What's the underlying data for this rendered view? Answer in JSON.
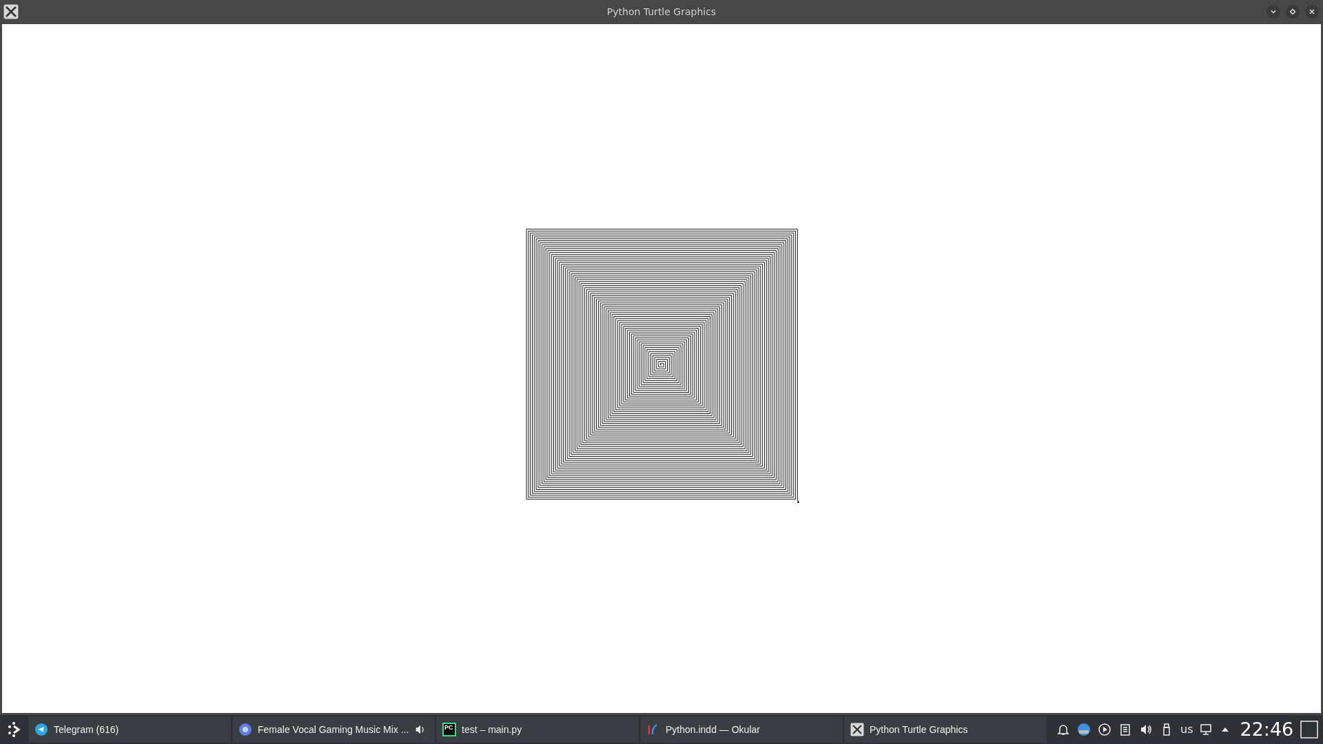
{
  "window": {
    "title": "Python Turtle Graphics"
  },
  "taskbar": {
    "tasks": [
      {
        "kind": "telegram",
        "label": "Telegram (616)",
        "audio": false
      },
      {
        "kind": "browser",
        "label": "Female Vocal Gaming Music Mix ...",
        "audio": true
      },
      {
        "kind": "ide",
        "label": "test – main.py",
        "audio": false,
        "icon_text": "PC"
      },
      {
        "kind": "viewer",
        "label": "Python.indd  — Okular",
        "audio": false
      },
      {
        "kind": "x",
        "label": "Python Turtle Graphics",
        "audio": false
      }
    ],
    "tray": {
      "keyboard_layout": "us",
      "clock": "22:46"
    }
  }
}
